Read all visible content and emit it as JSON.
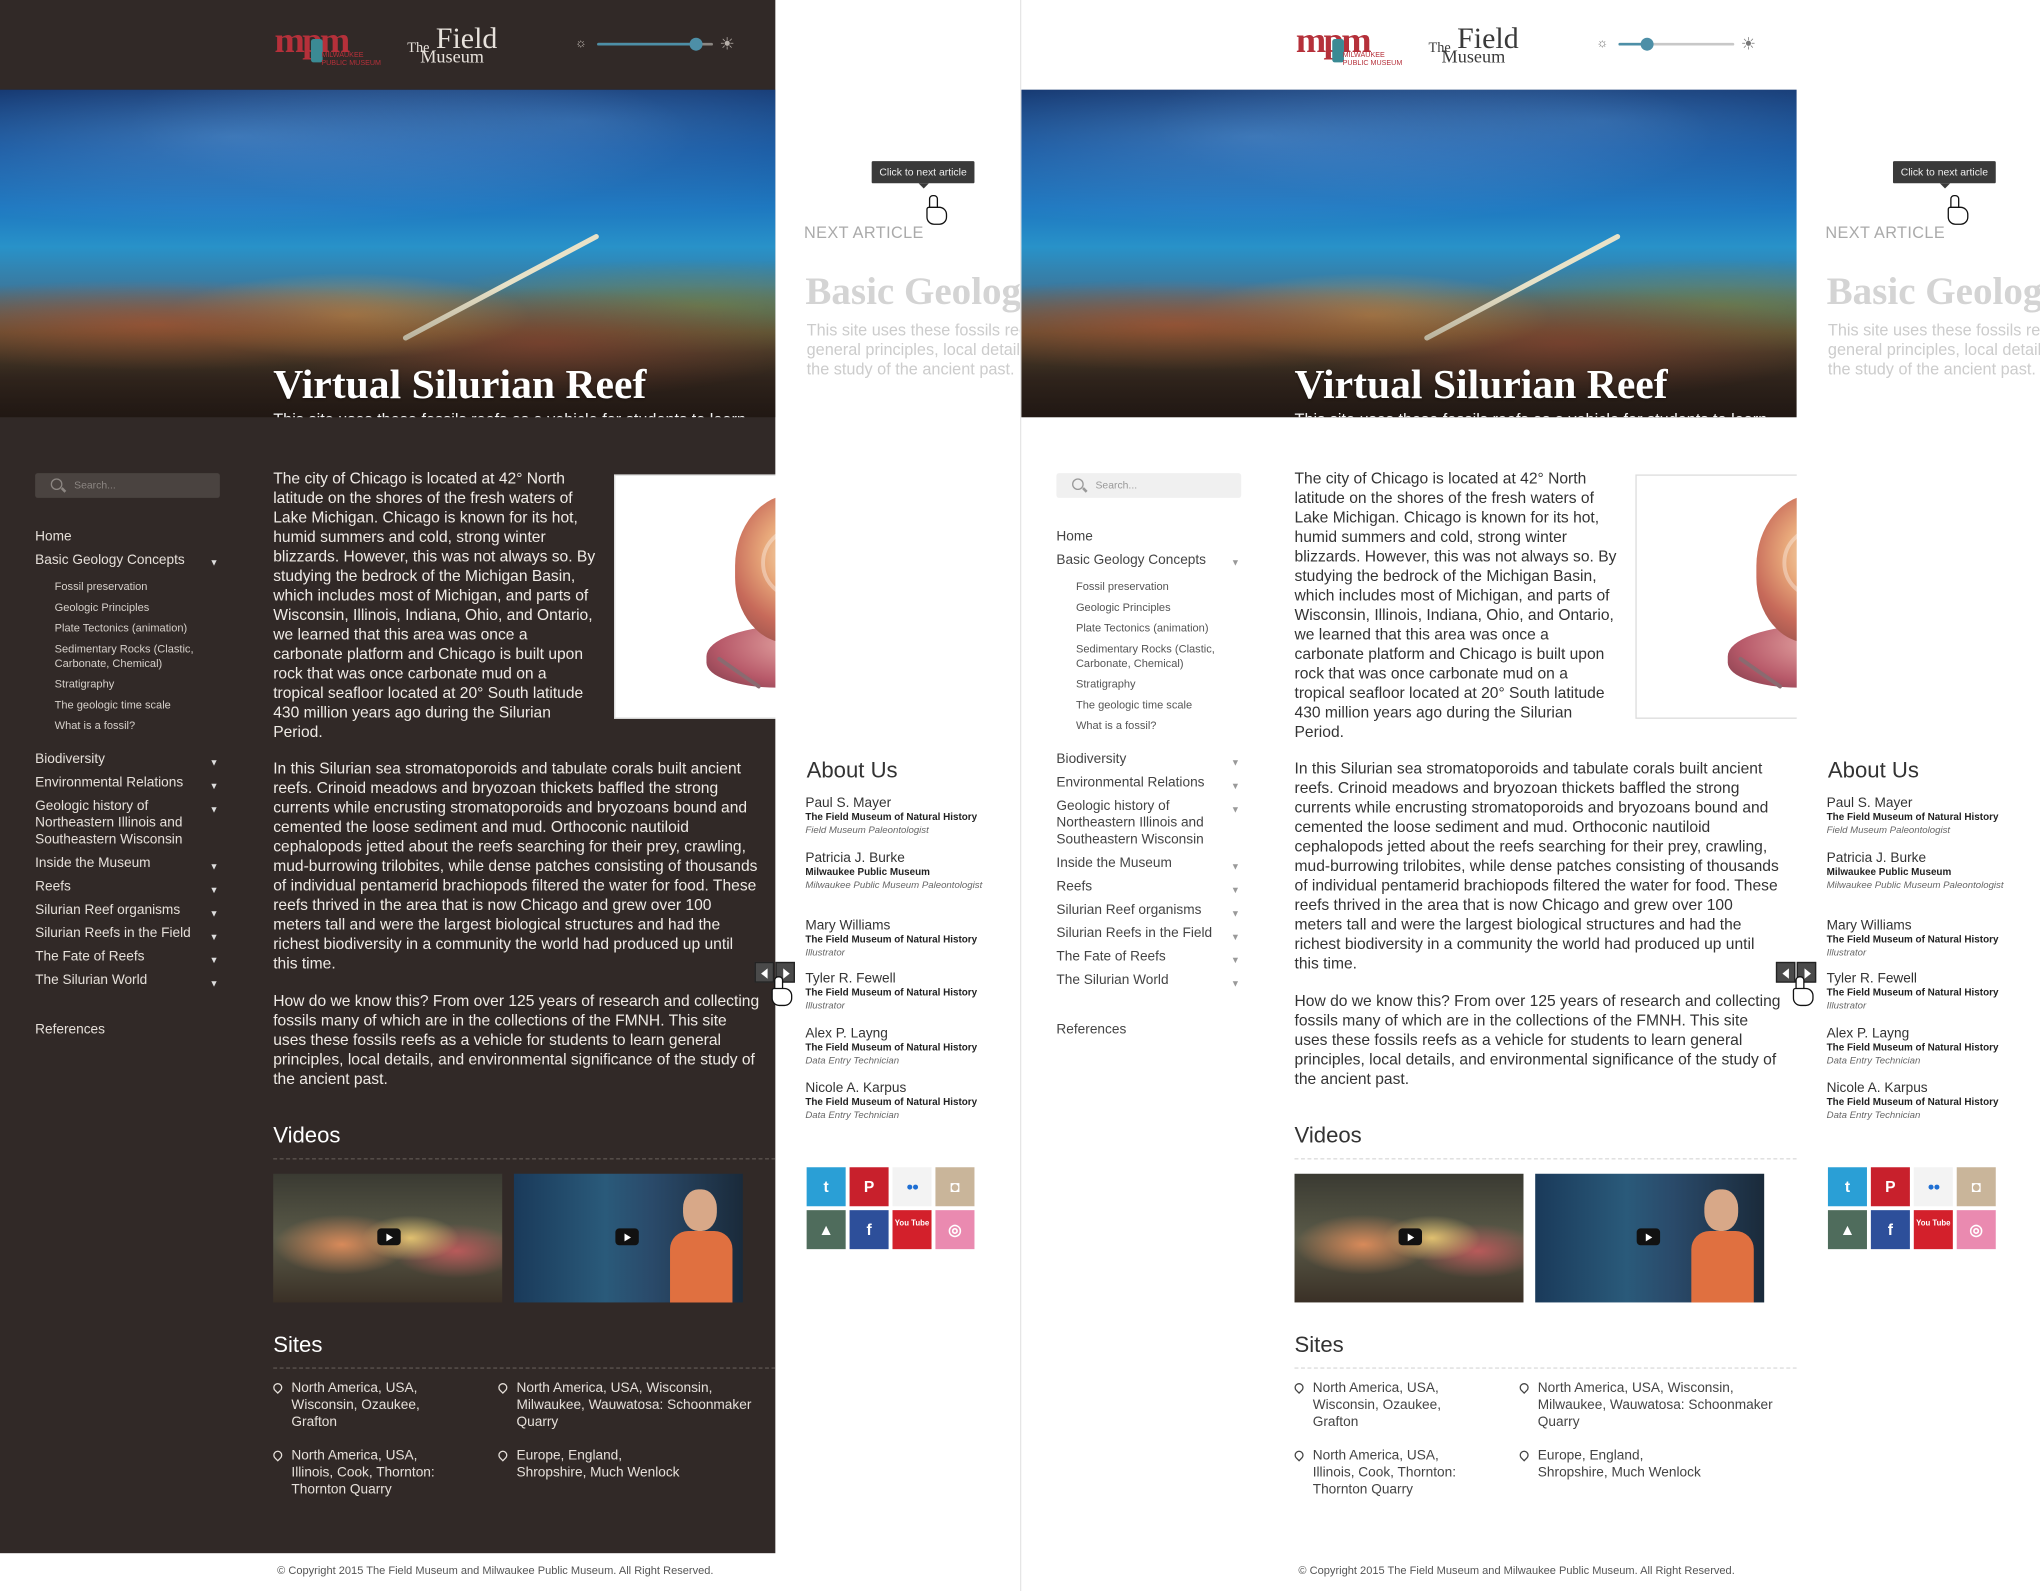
{
  "header": {
    "mpm_logo": {
      "mark": "mpm",
      "line1": "MILWAUKEE",
      "line2": "PUBLIC MUSEUM"
    },
    "field_logo": {
      "the": "The",
      "field": "Field",
      "museum": "Museum"
    },
    "brightness_slider": {
      "left_icon": "sun-small-icon",
      "right_icon": "sun-large-icon",
      "dark_level": 0.85,
      "light_level": 0.25
    }
  },
  "hero": {
    "title": "Virtual Silurian Reef",
    "description": "This site uses these fossils reefs as a vehicle for students to learn general principles, local details, and environmental significance of the study of the ancient past."
  },
  "search": {
    "placeholder": "Search..."
  },
  "nav": {
    "home": "Home",
    "basic_geology": "Basic Geology Concepts",
    "sub_items": [
      "Fossil preservation",
      "Geologic Principles",
      "Plate Tectonics (animation)",
      "Sedimentary Rocks (Clastic, Carbonate, Chemical)",
      "Stratigraphy",
      "The geologic time scale",
      "What is a fossil?"
    ],
    "items": [
      "Biodiversity",
      "Environmental Relations",
      "Geologic history of Northeastern Illinois and Southeastern Wisconsin",
      "Inside the Museum",
      "Reefs",
      "Silurian Reef organisms",
      "Silurian Reefs in the Field",
      "The Fate of Reefs",
      "The Silurian World"
    ],
    "references": "References",
    "caret": "▼"
  },
  "article": {
    "p1": "The city of Chicago is located at 42° North latitude on the shores of the fresh waters of Lake Michigan. Chicago is  known for its hot, humid summers and cold, strong winter blizzards. However, this was not always so. By  studying the bedrock of the Michigan Basin, which  includes most of Michigan, and parts of Wisconsin, Illinois, Indiana, Ohio, and Ontario, we learned that this  area was once a carbonate platform and Chicago is built upon rock that was once carbonate mud on a tropical seafloor located at 20° South latitude 430 million years ago during the Silurian Period.",
    "p2": "In this Silurian sea stromatoporoids and tabulate corals  built ancient reefs. Crinoid meadows and bryozoan  thickets baffled the strong currents while encrusting  stromatoporoids and bryozoans bound and cemented  the loose sediment and mud. Orthoconic nautiloid cephalopods jetted about the reefs searching for their  prey, crawling, mud-burrowing trilobites, while dense  patches consisting of thousands of individual pentamerid  brachiopods filtered the water for food. These reefs  thrived in the area that is now Chicago and grew over 100 meters tall and were the largest biological structures and had the richest biodiversity in a community the world had produced up until this time.",
    "p3": "How do we know this? From over 125 years of research and collecting fossils many of which are in the collections of the FMNH. This site uses these fossils reefs as a vehicle for students to learn general principles, local details, and environmental significance of the study of the ancient past."
  },
  "slideshow": {
    "active_dot": 1,
    "dot_count": 4
  },
  "videos": {
    "heading": "Videos",
    "items": [
      {
        "label": "reef-video"
      },
      {
        "label": "museum-video"
      }
    ]
  },
  "sites": {
    "heading": "Sites",
    "items": [
      "North America, USA, Wisconsin, Ozaukee, Grafton",
      "North America, USA, Wisconsin, Milwaukee, Wauwatosa: Schoonmaker Quarry",
      "North America, USA, Illinois, Cook, Thornton: Thornton Quarry",
      "Europe, England, Shropshire, Much Wenlock"
    ]
  },
  "next_article": {
    "tooltip": "Click to next article",
    "label": "NEXT ARTICLE",
    "title": "Basic Geology Concepts",
    "description_lines": [
      "This site uses these fossils reefs as a vehicle",
      "general principles, local details, and",
      "the study of the ancient past."
    ]
  },
  "about": {
    "heading": "About Us",
    "people": [
      {
        "name": "Paul S. Mayer",
        "org": "The Field Museum of Natural History",
        "role": "Field Museum Paleontologist"
      },
      {
        "name": "Patricia J. Burke",
        "org": "Milwaukee Public Museum",
        "role": "Milwaukee Public Museum Paleontologist"
      },
      {
        "name": "Mary Williams",
        "org": "The Field Museum of Natural History",
        "role": "Illustrator"
      },
      {
        "name": "Tyler R. Fewell",
        "org": "The Field Museum of Natural History",
        "role": "Illustrator"
      },
      {
        "name": "Alex P. Layng",
        "org": "The Field Museum of Natural History",
        "role": "Data Entry Technician"
      },
      {
        "name": "Nicole A. Karpus",
        "org": "The Field Museum of Natural History",
        "role": "Data Entry Technician"
      }
    ]
  },
  "social": [
    {
      "name": "twitter-icon",
      "glyph": "t",
      "color": "#2a9fd6"
    },
    {
      "name": "pinterest-icon",
      "glyph": "P",
      "color": "#c8202c"
    },
    {
      "name": "flickr-icon",
      "glyph": "●●",
      "color": "#f3f3f3"
    },
    {
      "name": "instagram-icon",
      "glyph": "◘",
      "color": "#c9b59a"
    },
    {
      "name": "deviantart-icon",
      "glyph": "▲",
      "color": "#4f6c5c"
    },
    {
      "name": "facebook-icon",
      "glyph": "f",
      "color": "#2d4f9a"
    },
    {
      "name": "youtube-icon",
      "glyph": "You Tube",
      "color": "#d3202b"
    },
    {
      "name": "dribbble-icon",
      "glyph": "◎",
      "color": "#ea8ab0"
    }
  ],
  "footer": {
    "copyright": "© Copyright 2015 The Field Museum and Milwaukee Public Museum. All Right Reserved."
  }
}
